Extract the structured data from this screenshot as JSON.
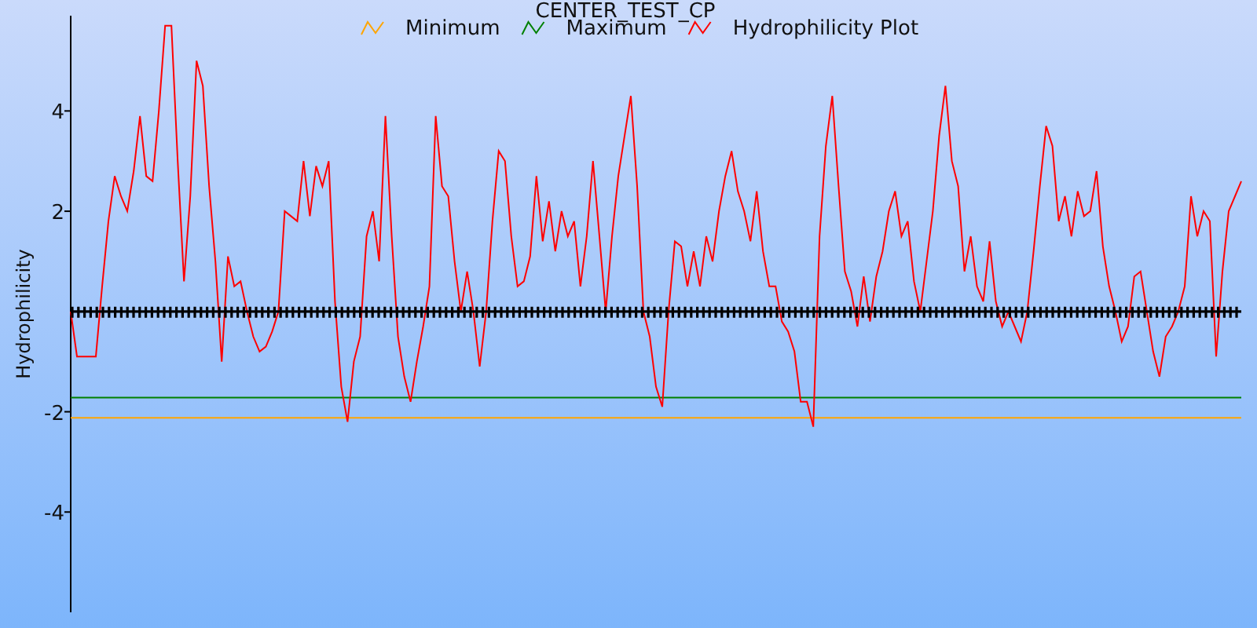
{
  "chart_data": {
    "type": "line",
    "title": "CENTER_TEST_CP",
    "ylabel": "Hydrophilicity",
    "ylim": [
      -6,
      5.9
    ],
    "yticks": [
      -4,
      -2,
      2,
      4
    ],
    "legend": true,
    "categories": [
      null,
      null,
      null,
      null,
      null,
      null,
      null,
      null,
      null,
      null,
      null,
      null,
      null,
      null,
      null,
      null,
      null,
      null,
      null,
      null,
      null,
      null,
      null,
      null,
      null,
      null,
      null,
      null,
      null,
      null,
      null,
      null,
      null,
      null,
      null,
      null,
      null,
      null,
      null,
      null,
      null,
      null,
      null,
      null,
      null,
      null,
      null,
      null,
      null,
      null,
      null,
      null,
      null,
      null,
      null,
      null,
      null,
      null,
      null,
      null,
      null,
      null,
      null,
      null,
      null,
      null,
      null,
      null,
      null,
      null,
      null,
      null,
      null,
      null,
      null,
      null,
      null,
      null,
      null,
      null,
      null,
      null,
      null,
      null,
      null,
      null,
      null,
      null,
      null,
      null,
      null,
      null,
      null,
      null,
      null,
      null,
      null,
      null,
      null,
      null,
      null,
      null,
      null,
      null,
      null,
      null,
      null,
      null,
      null,
      null,
      null,
      null,
      null,
      null,
      null,
      null,
      null,
      null,
      null,
      null,
      null,
      null,
      null,
      null,
      null,
      null,
      null,
      null,
      null,
      null,
      null,
      null,
      null,
      null,
      null,
      null,
      null,
      null,
      null,
      null,
      null,
      null,
      null,
      null,
      null,
      null,
      null,
      null,
      null,
      null,
      null,
      null,
      null,
      null,
      null,
      null,
      null,
      null,
      null,
      null,
      null,
      null,
      null,
      null,
      null,
      null,
      null,
      null,
      null,
      null,
      null,
      null,
      null,
      null,
      null,
      null,
      null,
      null,
      null,
      null,
      null,
      null,
      null,
      null,
      null,
      null,
      null
    ],
    "series": [
      {
        "name": "Minimum",
        "color": "#ffa500",
        "values": [
          -2.12,
          -2.12,
          -2.12,
          -2.12,
          -2.12,
          -2.12,
          -2.12,
          -2.12,
          -2.12,
          -2.12,
          -2.12,
          -2.12,
          -2.12,
          -2.12,
          -2.12,
          -2.12,
          -2.12,
          -2.12,
          -2.12,
          -2.12,
          -2.12,
          -2.12,
          -2.12,
          -2.12,
          -2.12,
          -2.12,
          -2.12,
          -2.12,
          -2.12,
          -2.12,
          -2.12,
          -2.12,
          -2.12,
          -2.12,
          -2.12,
          -2.12,
          -2.12,
          -2.12,
          -2.12,
          -2.12,
          -2.12,
          -2.12,
          -2.12,
          -2.12,
          -2.12,
          -2.12,
          -2.12,
          -2.12,
          -2.12,
          -2.12,
          -2.12,
          -2.12,
          -2.12,
          -2.12,
          -2.12,
          -2.12,
          -2.12,
          -2.12,
          -2.12,
          -2.12,
          -2.12,
          -2.12,
          -2.12,
          -2.12,
          -2.12,
          -2.12,
          -2.12,
          -2.12,
          -2.12,
          -2.12,
          -2.12,
          -2.12,
          -2.12,
          -2.12,
          -2.12,
          -2.12,
          -2.12,
          -2.12,
          -2.12,
          -2.12,
          -2.12,
          -2.12,
          -2.12,
          -2.12,
          -2.12,
          -2.12,
          -2.12,
          -2.12,
          -2.12,
          -2.12,
          -2.12,
          -2.12,
          -2.12,
          -2.12,
          -2.12,
          -2.12,
          -2.12,
          -2.12,
          -2.12,
          -2.12,
          -2.12,
          -2.12,
          -2.12,
          -2.12,
          -2.12,
          -2.12,
          -2.12,
          -2.12,
          -2.12,
          -2.12,
          -2.12,
          -2.12,
          -2.12,
          -2.12,
          -2.12,
          -2.12,
          -2.12,
          -2.12,
          -2.12,
          -2.12,
          -2.12,
          -2.12,
          -2.12,
          -2.12,
          -2.12,
          -2.12,
          -2.12,
          -2.12,
          -2.12,
          -2.12,
          -2.12,
          -2.12,
          -2.12,
          -2.12,
          -2.12,
          -2.12,
          -2.12,
          -2.12,
          -2.12,
          -2.12,
          -2.12,
          -2.12,
          -2.12,
          -2.12,
          -2.12,
          -2.12,
          -2.12,
          -2.12,
          -2.12,
          -2.12,
          -2.12,
          -2.12,
          -2.12,
          -2.12,
          -2.12,
          -2.12,
          -2.12,
          -2.12,
          -2.12,
          -2.12,
          -2.12,
          -2.12,
          -2.12,
          -2.12,
          -2.12,
          -2.12,
          -2.12,
          -2.12,
          -2.12,
          -2.12,
          -2.12,
          -2.12,
          -2.12,
          -2.12,
          -2.12,
          -2.12,
          -2.12,
          -2.12,
          -2.12,
          -2.12,
          -2.12,
          -2.12,
          -2.12,
          -2.12,
          -2.12,
          -2.12,
          -2.12
        ]
      },
      {
        "name": "Maximum",
        "color": "#008000",
        "values": [
          -1.72,
          -1.72,
          -1.72,
          -1.72,
          -1.72,
          -1.72,
          -1.72,
          -1.72,
          -1.72,
          -1.72,
          -1.72,
          -1.72,
          -1.72,
          -1.72,
          -1.72,
          -1.72,
          -1.72,
          -1.72,
          -1.72,
          -1.72,
          -1.72,
          -1.72,
          -1.72,
          -1.72,
          -1.72,
          -1.72,
          -1.72,
          -1.72,
          -1.72,
          -1.72,
          -1.72,
          -1.72,
          -1.72,
          -1.72,
          -1.72,
          -1.72,
          -1.72,
          -1.72,
          -1.72,
          -1.72,
          -1.72,
          -1.72,
          -1.72,
          -1.72,
          -1.72,
          -1.72,
          -1.72,
          -1.72,
          -1.72,
          -1.72,
          -1.72,
          -1.72,
          -1.72,
          -1.72,
          -1.72,
          -1.72,
          -1.72,
          -1.72,
          -1.72,
          -1.72,
          -1.72,
          -1.72,
          -1.72,
          -1.72,
          -1.72,
          -1.72,
          -1.72,
          -1.72,
          -1.72,
          -1.72,
          -1.72,
          -1.72,
          -1.72,
          -1.72,
          -1.72,
          -1.72,
          -1.72,
          -1.72,
          -1.72,
          -1.72,
          -1.72,
          -1.72,
          -1.72,
          -1.72,
          -1.72,
          -1.72,
          -1.72,
          -1.72,
          -1.72,
          -1.72,
          -1.72,
          -1.72,
          -1.72,
          -1.72,
          -1.72,
          -1.72,
          -1.72,
          -1.72,
          -1.72,
          -1.72,
          -1.72,
          -1.72,
          -1.72,
          -1.72,
          -1.72,
          -1.72,
          -1.72,
          -1.72,
          -1.72,
          -1.72,
          -1.72,
          -1.72,
          -1.72,
          -1.72,
          -1.72,
          -1.72,
          -1.72,
          -1.72,
          -1.72,
          -1.72,
          -1.72,
          -1.72,
          -1.72,
          -1.72,
          -1.72,
          -1.72,
          -1.72,
          -1.72,
          -1.72,
          -1.72,
          -1.72,
          -1.72,
          -1.72,
          -1.72,
          -1.72,
          -1.72,
          -1.72,
          -1.72,
          -1.72,
          -1.72,
          -1.72,
          -1.72,
          -1.72,
          -1.72,
          -1.72,
          -1.72,
          -1.72,
          -1.72,
          -1.72,
          -1.72,
          -1.72,
          -1.72,
          -1.72,
          -1.72,
          -1.72,
          -1.72,
          -1.72,
          -1.72,
          -1.72,
          -1.72,
          -1.72,
          -1.72,
          -1.72,
          -1.72,
          -1.72,
          -1.72,
          -1.72,
          -1.72,
          -1.72,
          -1.72,
          -1.72,
          -1.72,
          -1.72,
          -1.72,
          -1.72,
          -1.72,
          -1.72,
          -1.72,
          -1.72,
          -1.72,
          -1.72,
          -1.72,
          -1.72,
          -1.72,
          -1.72,
          -1.72,
          -1.72
        ]
      },
      {
        "name": "Hydrophilicity Plot",
        "color": "#ff0000",
        "values": [
          0,
          -0.9,
          -0.9,
          -0.9,
          -0.9,
          0.5,
          1.8,
          2.7,
          2.3,
          2.0,
          2.8,
          3.9,
          2.7,
          2.6,
          4.0,
          5.7,
          5.7,
          3,
          0.6,
          2.3,
          5.0,
          4.5,
          2.5,
          1.0,
          -1.0,
          1.1,
          0.5,
          0.6,
          0.0,
          -0.5,
          -0.8,
          -0.7,
          -0.4,
          0.0,
          2.0,
          1.9,
          1.8,
          3.0,
          1.9,
          2.9,
          2.5,
          3.0,
          0.2,
          -1.5,
          -2.2,
          -1.0,
          -0.5,
          1.5,
          2.0,
          1.0,
          3.9,
          1.5,
          -0.5,
          -1.3,
          -1.8,
          -1.0,
          -0.3,
          0.5,
          3.9,
          2.5,
          2.3,
          1.0,
          0.0,
          0.8,
          0.0,
          -1.1,
          0,
          1.8,
          3.2,
          3.0,
          1.5,
          0.5,
          0.6,
          1.1,
          2.7,
          1.4,
          2.2,
          1.2,
          2.0,
          1.5,
          1.8,
          0.5,
          1.5,
          3.0,
          1.5,
          0.0,
          1.5,
          2.7,
          3.5,
          4.3,
          2.5,
          0.0,
          -0.5,
          -1.5,
          -1.9,
          0.0,
          1.4,
          1.3,
          0.5,
          1.2,
          0.5,
          1.5,
          1.0,
          2.0,
          2.7,
          3.2,
          2.4,
          2.0,
          1.4,
          2.4,
          1.2,
          0.5,
          0.5,
          -0.2,
          -0.4,
          -0.8,
          -1.8,
          -1.8,
          -2.3,
          1.5,
          3.3,
          4.3,
          2.5,
          0.8,
          0.4,
          -0.3,
          0.7,
          -0.2,
          0.7,
          1.2,
          2.0,
          2.4,
          1.5,
          1.8,
          0.6,
          0.0,
          1.0,
          2.0,
          3.5,
          4.5,
          3.0,
          2.5,
          0.8,
          1.5,
          0.5,
          0.2,
          1.4,
          0.2,
          -0.3,
          0.0,
          -0.3,
          -0.6,
          0.0,
          1.2,
          2.5,
          3.7,
          3.3,
          1.8,
          2.3,
          1.5,
          2.4,
          1.9,
          2.0,
          2.8,
          1.3,
          0.5,
          0.0,
          -0.6,
          -0.3,
          0.7,
          0.8,
          0.0,
          -0.8,
          -1.3,
          -0.5,
          -0.3,
          0.0,
          0.5,
          2.3,
          1.5,
          2.0,
          1.8,
          -0.9,
          0.8,
          2.0,
          2.3,
          2.6
        ]
      }
    ]
  }
}
